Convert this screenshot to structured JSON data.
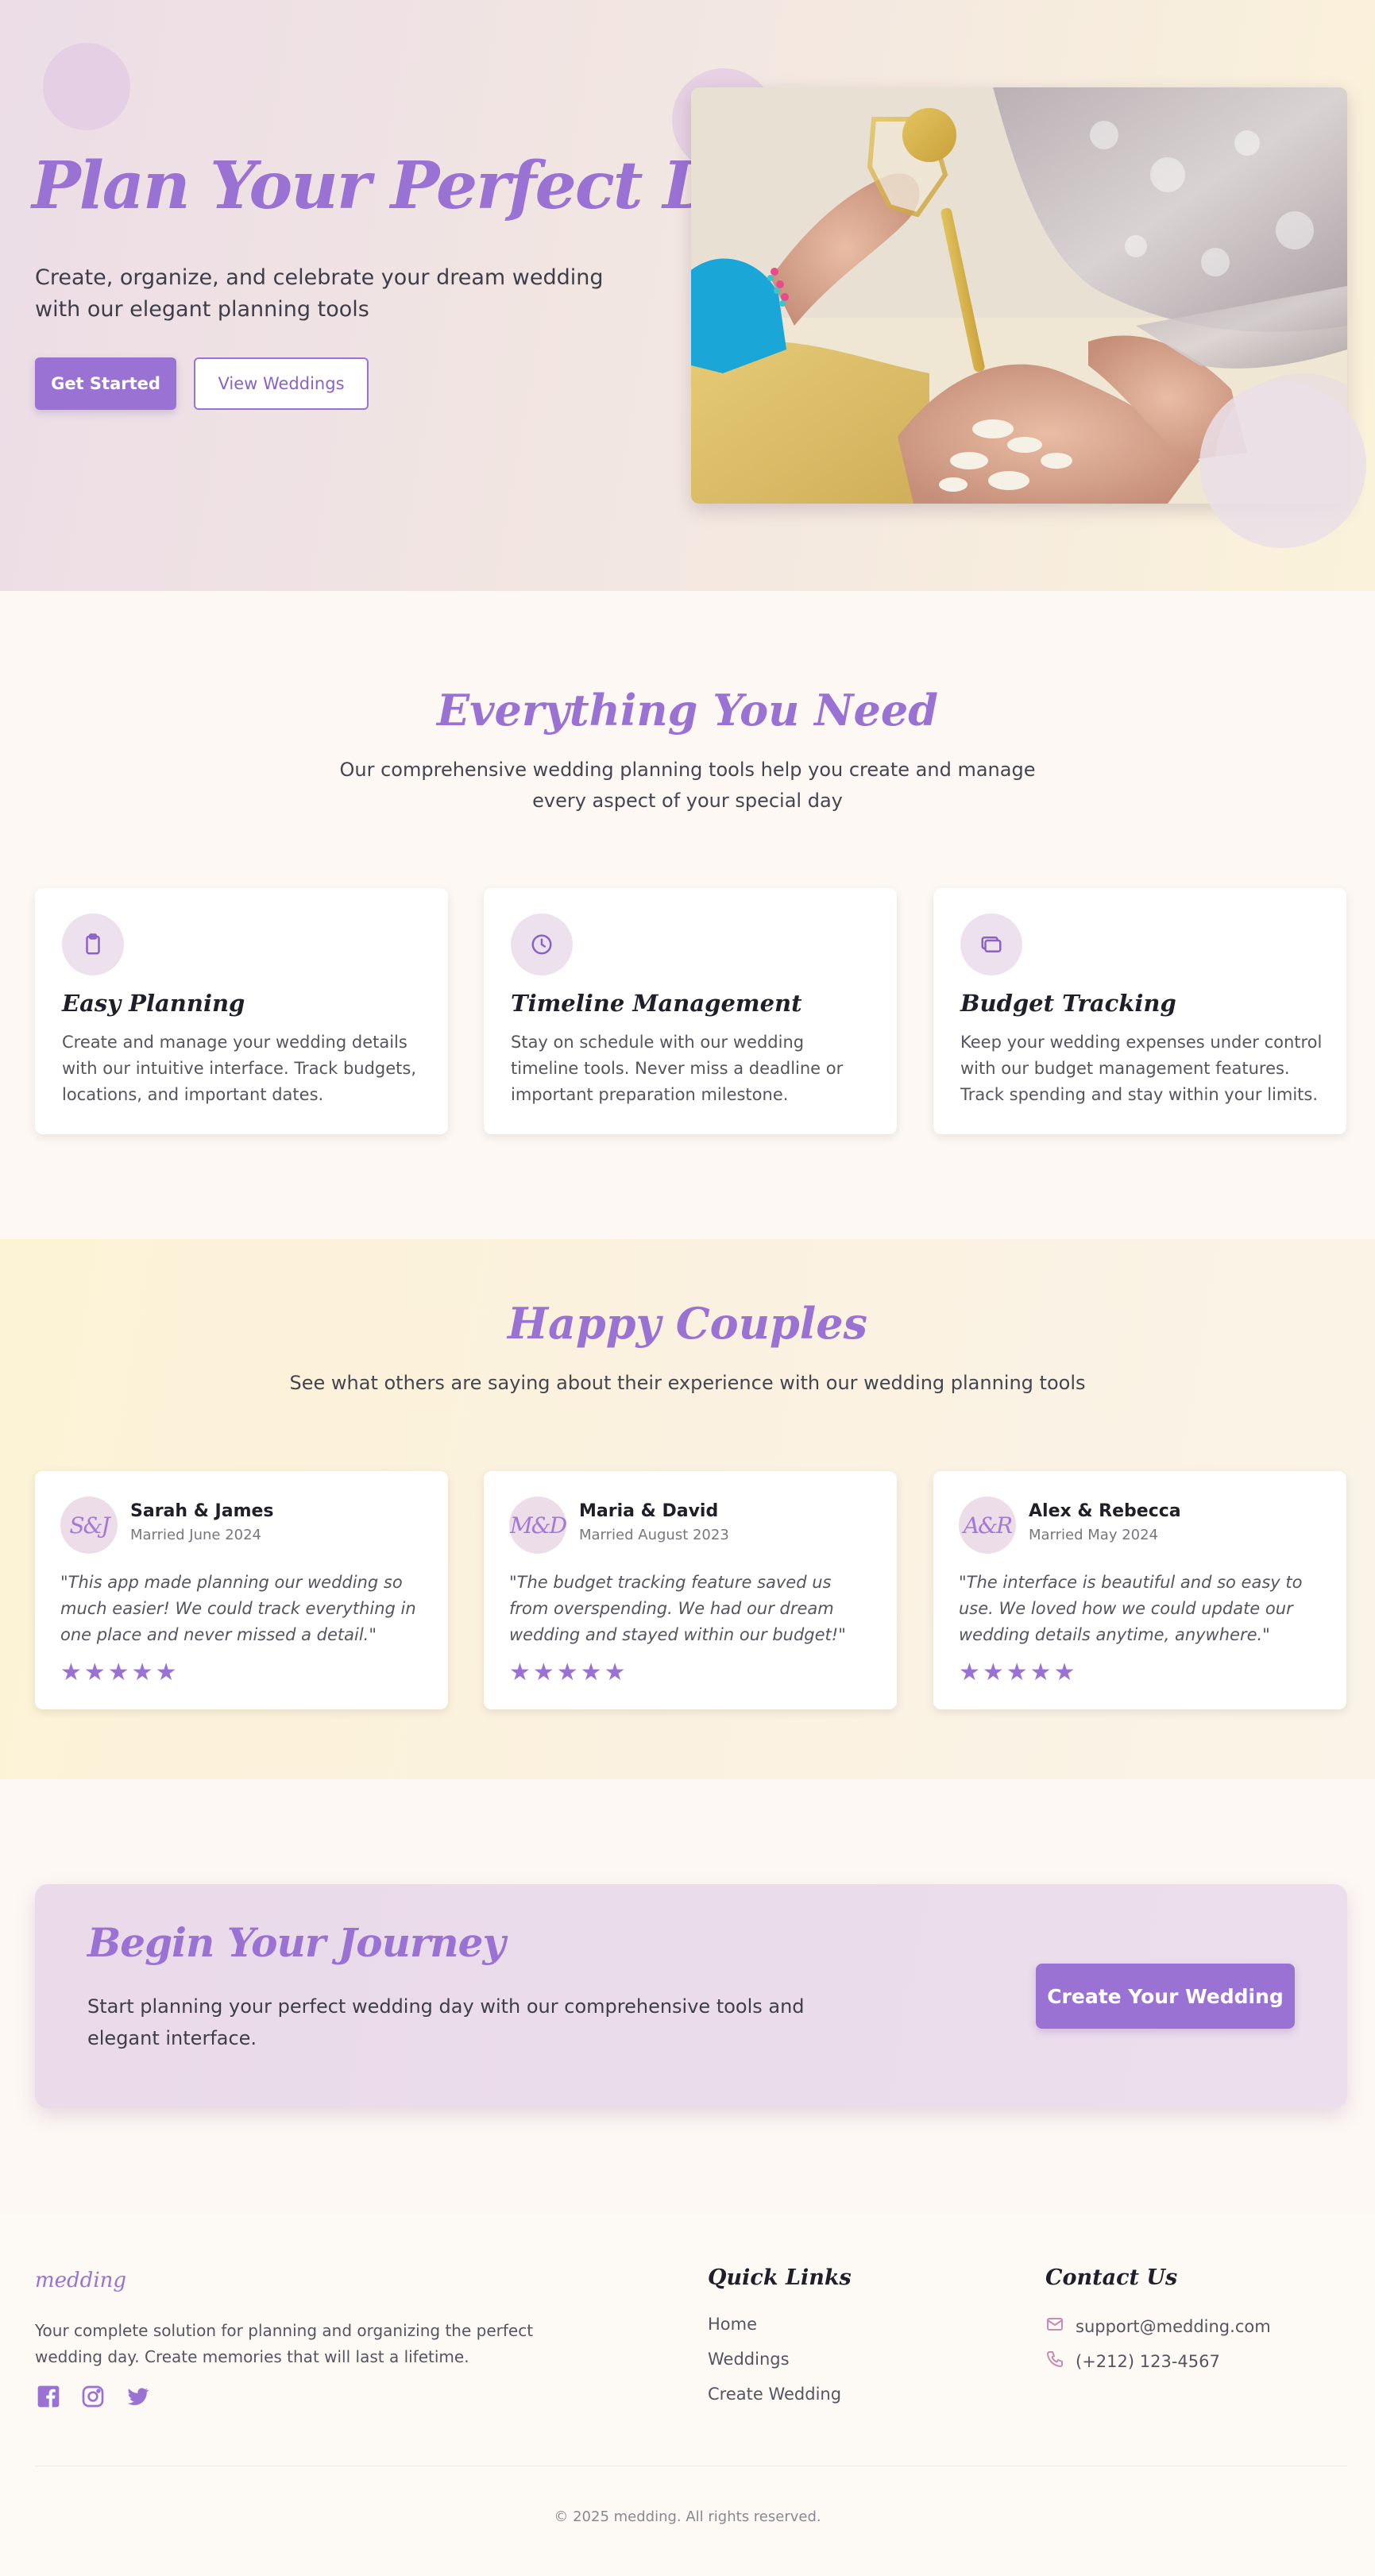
{
  "hero": {
    "title": "Plan Your Perfect Day",
    "subtitle": "Create, organize, and celebrate your dream wedding with our elegant planning tools",
    "primary_button": "Get Started",
    "secondary_button": "View Weddings"
  },
  "features": {
    "title": "Everything You Need",
    "subtitle": "Our comprehensive wedding planning tools help you create and manage every aspect of your special day",
    "cards": [
      {
        "icon": "clipboard-icon",
        "title": "Easy Planning",
        "desc": "Create and manage your wedding details with our intuitive interface. Track budgets, locations, and important dates."
      },
      {
        "icon": "clock-icon",
        "title": "Timeline Management",
        "desc": "Stay on schedule with our wedding timeline tools. Never miss a deadline or important preparation milestone."
      },
      {
        "icon": "wallet-icon",
        "title": "Budget Tracking",
        "desc": "Keep your wedding expenses under control with our budget management features. Track spending and stay within your limits."
      }
    ]
  },
  "testimonials": {
    "title": "Happy Couples",
    "subtitle": "See what others are saying about their experience with our wedding planning tools",
    "items": [
      {
        "initials": "S&J",
        "name": "Sarah & James",
        "date": "Married June 2024",
        "quote": "\"This app made planning our wedding so much easier! We could track everything in one place and never missed a detail.\"",
        "rating": 5
      },
      {
        "initials": "M&D",
        "name": "Maria & David",
        "date": "Married August 2023",
        "quote": "\"The budget tracking feature saved us from overspending. We had our dream wedding and stayed within our budget!\"",
        "rating": 5
      },
      {
        "initials": "A&R",
        "name": "Alex & Rebecca",
        "date": "Married May 2024",
        "quote": "\"The interface is beautiful and so easy to use. We loved how we could update our wedding details anytime, anywhere.\"",
        "rating": 5
      }
    ]
  },
  "cta": {
    "title": "Begin Your Journey",
    "text": "Start planning your perfect wedding day with our comprehensive tools and elegant interface.",
    "button": "Create Your Wedding"
  },
  "footer": {
    "logo": "medding",
    "description": "Your complete solution for planning and organizing the perfect wedding day. Create memories that will last a lifetime.",
    "social": [
      "facebook-icon",
      "instagram-icon",
      "twitter-icon"
    ],
    "quick_links_title": "Quick Links",
    "quick_links": [
      "Home",
      "Weddings",
      "Create Wedding"
    ],
    "contact_title": "Contact Us",
    "email": "support@medding.com",
    "phone": "(+212) 123-4567",
    "copyright": "© 2025 medding. All rights reserved."
  },
  "colors": {
    "accent": "#9a72d4",
    "hero_bg_left": "#ecdde6",
    "hero_bg_right": "#fbf2da",
    "testimonial_bg": "#fcf3d6"
  }
}
